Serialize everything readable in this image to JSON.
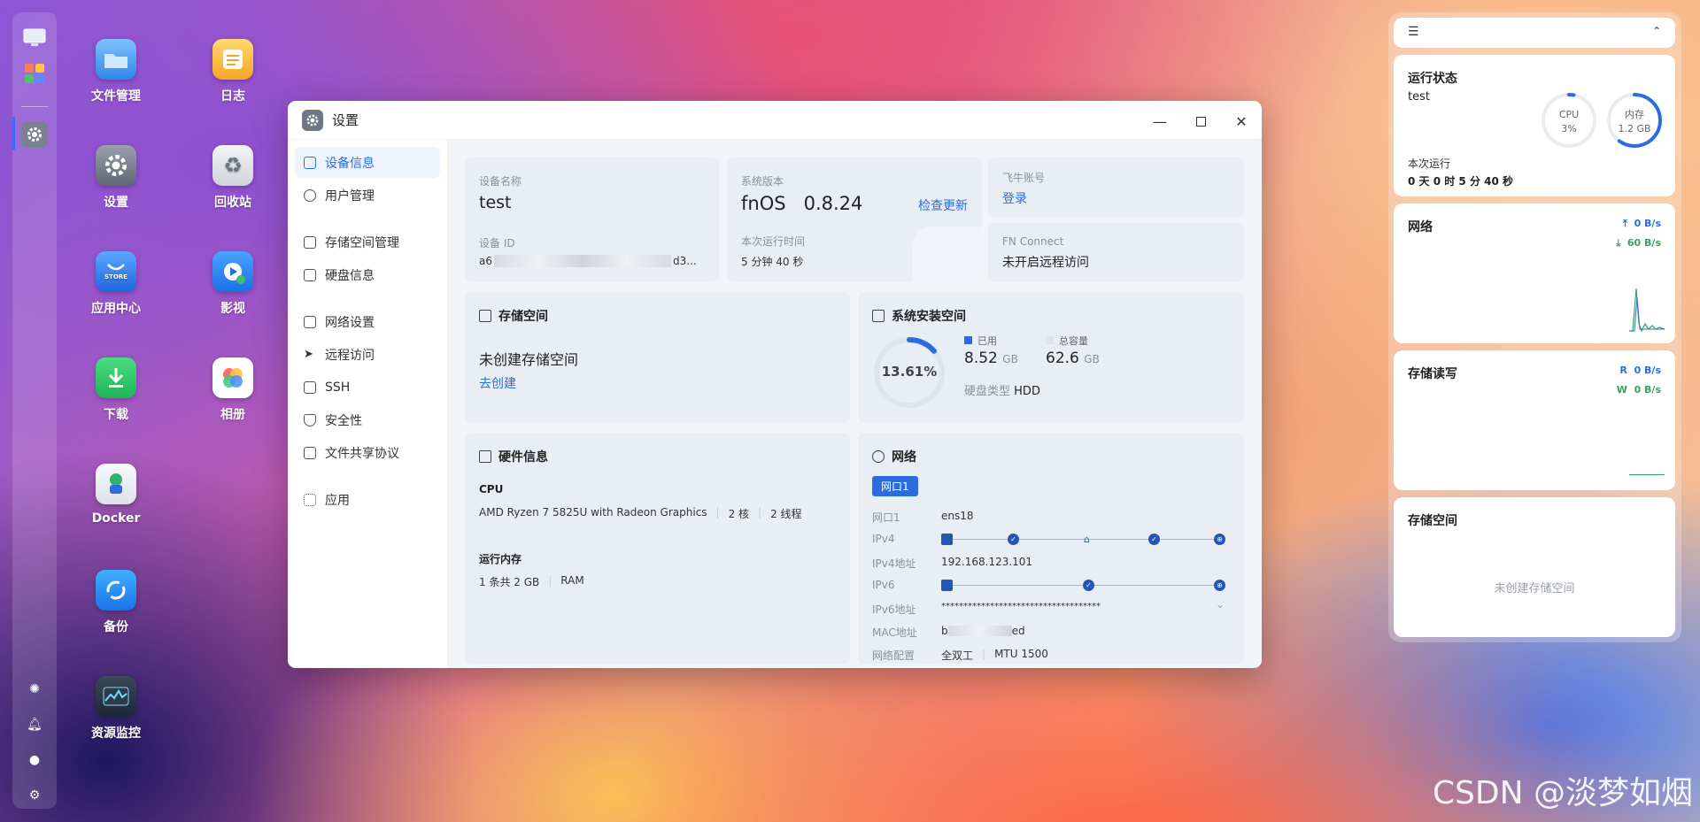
{
  "desktop_apps": [
    {
      "label": "文件管理",
      "icon": "folder-icon"
    },
    {
      "label": "日志",
      "icon": "log-icon"
    },
    {
      "label": "设置",
      "icon": "gear-icon"
    },
    {
      "label": "回收站",
      "icon": "recycle-icon"
    },
    {
      "label": "应用中心",
      "icon": "store-icon",
      "badge": "STORE"
    },
    {
      "label": "影视",
      "icon": "video-icon"
    },
    {
      "label": "下载",
      "icon": "download-icon"
    },
    {
      "label": "相册",
      "icon": "photos-icon"
    },
    {
      "label": "Docker",
      "icon": "docker-icon"
    },
    {
      "label": "备份",
      "icon": "backup-icon"
    },
    {
      "label": "资源监控",
      "icon": "monitor-icon"
    }
  ],
  "window": {
    "title": "设置",
    "nav": [
      {
        "label": "设备信息",
        "active": true
      },
      {
        "label": "用户管理"
      },
      {
        "label": "存储空间管理"
      },
      {
        "label": "硬盘信息"
      },
      {
        "label": "网络设置"
      },
      {
        "label": "远程访问"
      },
      {
        "label": "SSH"
      },
      {
        "label": "安全性"
      },
      {
        "label": "文件共享协议"
      },
      {
        "label": "应用"
      }
    ],
    "device": {
      "name_label": "设备名称",
      "name": "test",
      "id_label": "设备 ID",
      "id_start": "a6",
      "id_end": "d3...",
      "version_label": "系统版本",
      "os": "fnOS",
      "version": "0.8.24",
      "check_update": "检查更新",
      "uptime_label": "本次运行时间",
      "uptime": "5 分钟 40 秒",
      "account_label": "飞牛账号",
      "login": "登录",
      "fnconnect_label": "FN Connect",
      "fnconnect_value": "未开启远程访问"
    },
    "storage": {
      "title": "存储空间",
      "empty": "未创建存储空间",
      "create": "去创建"
    },
    "system_storage": {
      "title": "系统安装空间",
      "percent_text": "13.61%",
      "percent": 13.61,
      "used_label": "已用",
      "used_value": "8.52",
      "used_unit": "GB",
      "total_label": "总容量",
      "total_value": "62.6",
      "total_unit": "GB",
      "disk_type_label": "硬盘类型",
      "disk_type": "HDD"
    },
    "hardware": {
      "title": "硬件信息",
      "cpu_label": "CPU",
      "cpu_model": "AMD Ryzen 7 5825U with Radeon Graphics",
      "cores": "2 核",
      "threads": "2 线程",
      "mem_label": "运行内存",
      "mem_value": "1 条共 2 GB",
      "mem_type": "RAM"
    },
    "network": {
      "title": "网络",
      "tab": "网口1",
      "port_label": "网口1",
      "port": "ens18",
      "ipv4_label": "IPv4",
      "ipv4_addr_label": "IPv4地址",
      "ipv4_addr": "192.168.123.101",
      "ipv6_label": "IPv6",
      "ipv6_addr_label": "IPv6地址",
      "ipv6_addr": "************************************",
      "mac_label": "MAC地址",
      "mac_start": "b",
      "mac_end": "ed",
      "config_label": "网络配置",
      "duplex": "全双工",
      "mtu": "MTU 1500"
    }
  },
  "right_panel": {
    "status": {
      "title": "运行状态",
      "host": "test",
      "cpu_label": "CPU",
      "cpu": "3%",
      "cpu_value": 3,
      "mem_label": "内存",
      "mem": "1.2 GB",
      "mem_fraction": 0.6,
      "uptime_label": "本次运行",
      "uptime": "0 天 0 时 5 分 40 秒"
    },
    "network": {
      "title": "网络",
      "up": "0 B/s",
      "down": "60 B/s"
    },
    "disk_io": {
      "title": "存储读写",
      "read_label": "R",
      "read": "0 B/s",
      "write_label": "W",
      "write": "0 B/s"
    },
    "storage": {
      "title": "存储空间",
      "empty": "未创建存储空间"
    }
  },
  "watermark": "CSDN @淡梦如烟",
  "colors": {
    "accent": "#2b6de0",
    "upload": "#2b6de0",
    "download": "#3aa060",
    "card": "#e9eef5"
  }
}
